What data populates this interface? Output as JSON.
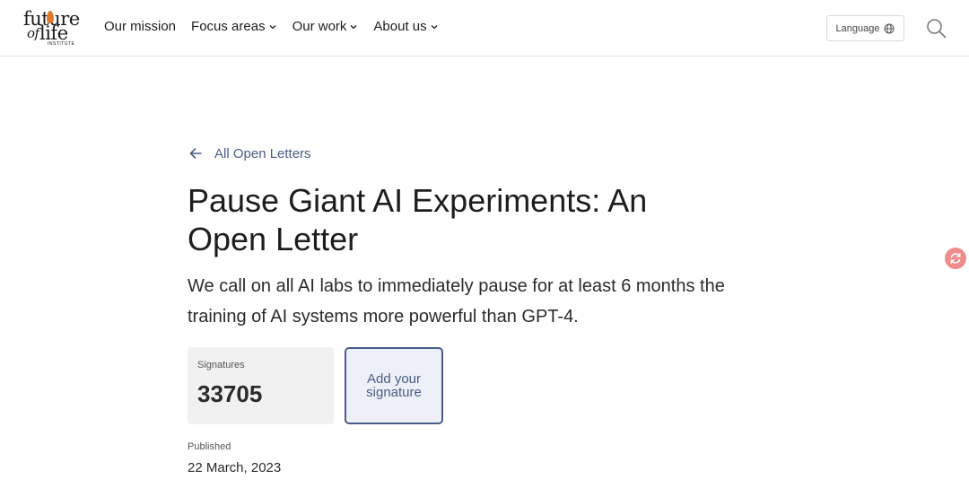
{
  "header": {
    "logo": {
      "line1": "future",
      "line2": "of",
      "line2b": "life",
      "line3": "INSTITUTE"
    },
    "nav": [
      {
        "label": "Our mission",
        "has_dropdown": false
      },
      {
        "label": "Focus areas",
        "has_dropdown": true
      },
      {
        "label": "Our work",
        "has_dropdown": true
      },
      {
        "label": "About us",
        "has_dropdown": true
      }
    ],
    "language_label": "Language",
    "icons": {
      "language": "globe-icon",
      "search": "search-icon",
      "dropdown": "chevron-down-icon"
    }
  },
  "main": {
    "back_link": "All Open Letters",
    "title": "Pause Giant AI Experiments: An Open Letter",
    "lead": "We call on all AI labs to immediately pause for at least 6 months the training of AI systems more powerful than GPT-4.",
    "signatures": {
      "label": "Signatures",
      "count": "33705"
    },
    "add_signature_label": "Add your signature",
    "published": {
      "label": "Published",
      "date": "22 March, 2023"
    }
  },
  "colors": {
    "accent": "#4a5d86",
    "button_bg": "#eef0f9",
    "signature_box_bg": "#f1f1f1",
    "floating_icon": "#ee8d8d",
    "logo_flame": "#e07a2e"
  }
}
